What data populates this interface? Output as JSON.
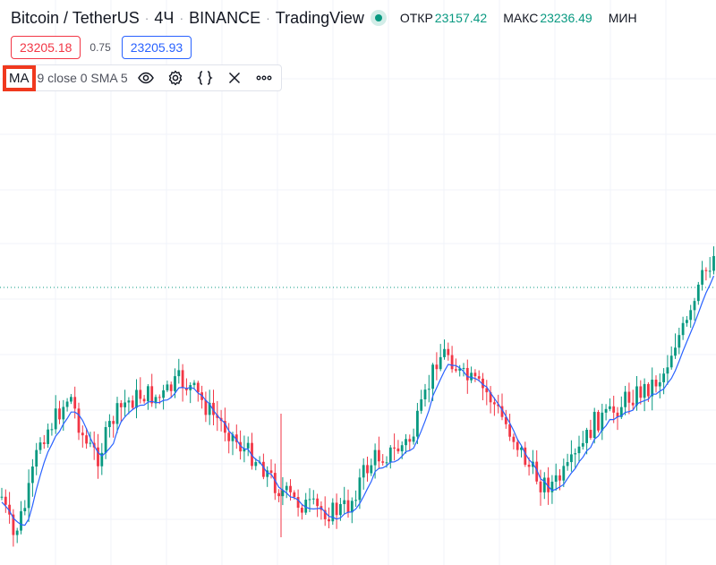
{
  "header": {
    "symbol": "Bitcoin / TetherUS",
    "interval": "4Ч",
    "exchange": "BINANCE",
    "source": "TradingView",
    "ohlc": [
      {
        "label": "ОТКР",
        "value": "23157.42"
      },
      {
        "label": "МАКС",
        "value": "23236.49"
      },
      {
        "label": "МИН",
        "value": ""
      }
    ]
  },
  "prices": {
    "bid": "23205.18",
    "spread": "0.75",
    "ask": "23205.93"
  },
  "indicator": {
    "name": "MA",
    "params": "9 close 0 SMA 5",
    "icons": [
      "eye-icon",
      "gear-icon",
      "braces-icon",
      "close-icon",
      "more-icon"
    ]
  },
  "colors": {
    "up": "#089981",
    "down": "#f23645",
    "ma": "#2962ff",
    "grid": "#f0f3fa",
    "highlight": "#f0391e"
  }
}
